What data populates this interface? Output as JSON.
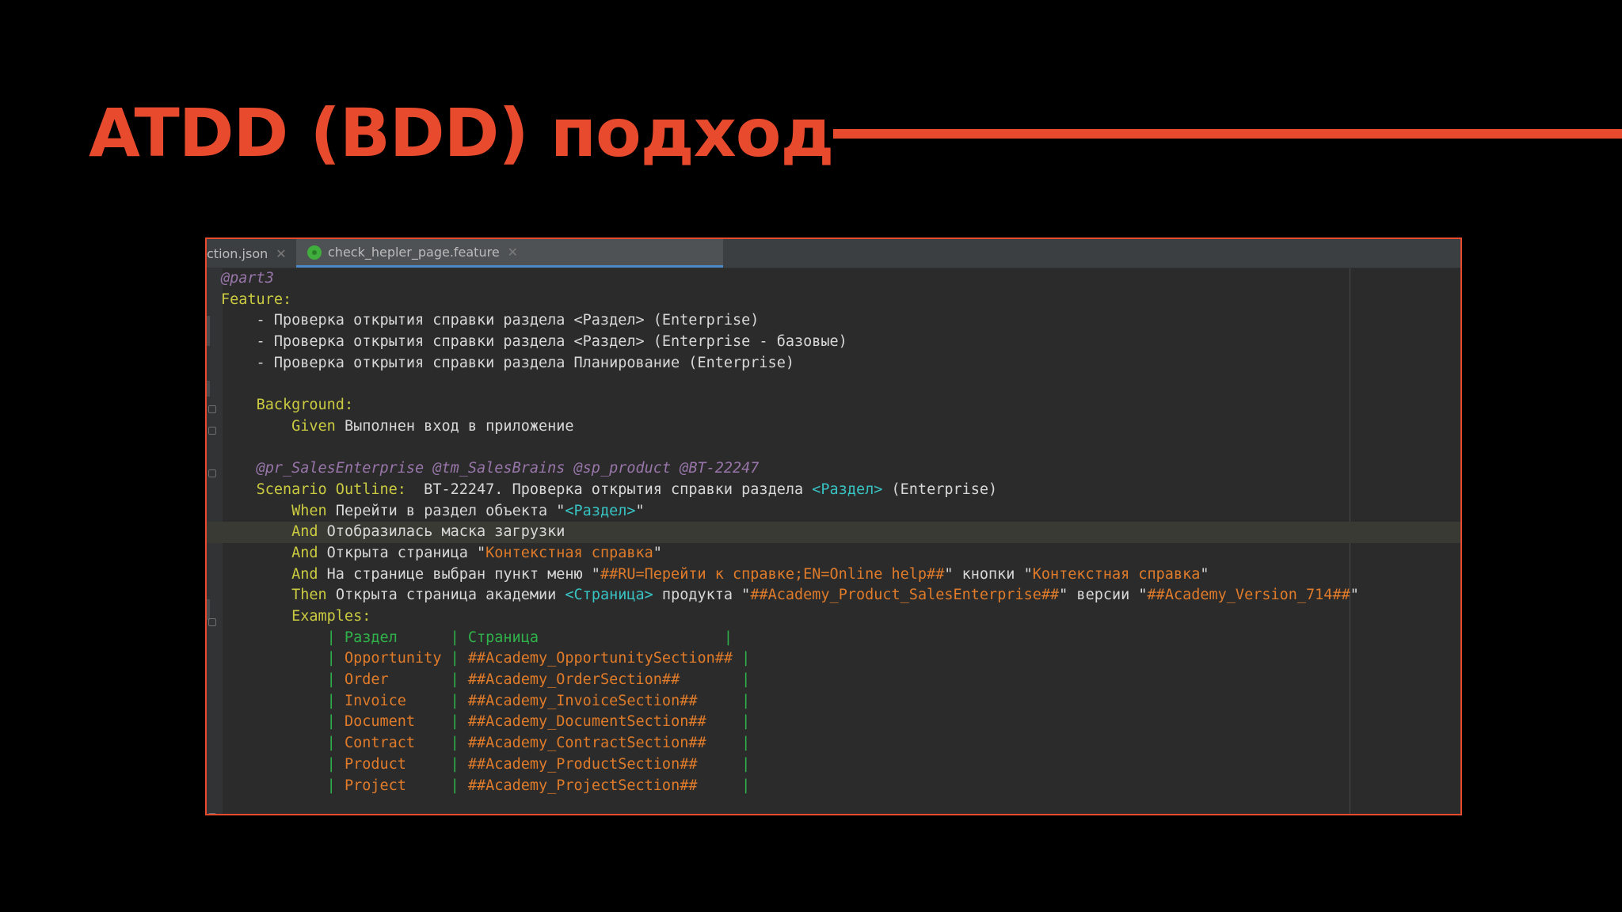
{
  "slide": {
    "title": "ATDD (BDD) подход",
    "accent_color": "#e84a2e",
    "background_color": "#000000"
  },
  "editor": {
    "tabs": [
      {
        "label": "ction.json",
        "active": false,
        "close_icon": "close-icon"
      },
      {
        "label": "check_hepler_page.feature",
        "active": true,
        "icon": "feature-file-icon",
        "close_icon": "close-icon"
      }
    ],
    "colors": {
      "background": "#2b2b2b",
      "tag": "#9876aa",
      "keyword": "#cbcb41",
      "placeholder": "#38c4c4",
      "string": "#e07b2a",
      "table": "#2fb34a",
      "text": "#d8d8d8"
    },
    "lines": [
      [
        {
          "t": "tag",
          "v": "@part3"
        }
      ],
      [
        {
          "t": "kw",
          "v": "Feature:"
        }
      ],
      [
        {
          "t": "txt",
          "v": "    - Проверка открытия справки раздела <Раздел> (Enterprise)"
        }
      ],
      [
        {
          "t": "txt",
          "v": "    - Проверка открытия справки раздела <Раздел> (Enterprise - базовые)"
        }
      ],
      [
        {
          "t": "txt",
          "v": "    - Проверка открытия справки раздела Планирование (Enterprise)"
        }
      ],
      [
        {
          "t": "txt",
          "v": ""
        }
      ],
      [
        {
          "t": "txt",
          "v": "    "
        },
        {
          "t": "kw",
          "v": "Background:"
        }
      ],
      [
        {
          "t": "txt",
          "v": "        "
        },
        {
          "t": "kw",
          "v": "Given "
        },
        {
          "t": "txt",
          "v": "Выполнен вход в приложение"
        }
      ],
      [
        {
          "t": "txt",
          "v": ""
        }
      ],
      [
        {
          "t": "txt",
          "v": "    "
        },
        {
          "t": "tag",
          "v": "@pr_SalesEnterprise @tm_SalesBrains @sp_product @BT-22247"
        }
      ],
      [
        {
          "t": "txt",
          "v": "    "
        },
        {
          "t": "kw",
          "v": "Scenario Outline: "
        },
        {
          "t": "txt",
          "v": " BT-22247. Проверка открытия справки раздела "
        },
        {
          "t": "ph",
          "v": "<Раздел>"
        },
        {
          "t": "txt",
          "v": " (Enterprise)"
        }
      ],
      [
        {
          "t": "txt",
          "v": "        "
        },
        {
          "t": "kw",
          "v": "When "
        },
        {
          "t": "txt",
          "v": "Перейти в раздел объекта \""
        },
        {
          "t": "ph",
          "v": "<Раздел>"
        },
        {
          "t": "txt",
          "v": "\""
        }
      ],
      [
        {
          "t": "txt",
          "v": "        "
        },
        {
          "t": "kw",
          "v": "And "
        },
        {
          "t": "txt",
          "v": "Отобразилась маска загрузки"
        }
      ],
      [
        {
          "t": "txt",
          "v": "        "
        },
        {
          "t": "kw",
          "v": "And "
        },
        {
          "t": "txt",
          "v": "Открыта страница \""
        },
        {
          "t": "str",
          "v": "Контекстная справка"
        },
        {
          "t": "txt",
          "v": "\""
        }
      ],
      [
        {
          "t": "txt",
          "v": "        "
        },
        {
          "t": "kw",
          "v": "And "
        },
        {
          "t": "txt",
          "v": "На странице выбран пункт меню \""
        },
        {
          "t": "str",
          "v": "##RU=Перейти к справке;EN=Online help##"
        },
        {
          "t": "txt",
          "v": "\" кнопки \""
        },
        {
          "t": "str",
          "v": "Контекстная справка"
        },
        {
          "t": "txt",
          "v": "\""
        }
      ],
      [
        {
          "t": "txt",
          "v": "        "
        },
        {
          "t": "kw",
          "v": "Then "
        },
        {
          "t": "txt",
          "v": "Открыта страница академии "
        },
        {
          "t": "ph",
          "v": "<Страница>"
        },
        {
          "t": "txt",
          "v": " продукта \""
        },
        {
          "t": "str",
          "v": "##Academy_Product_SalesEnterprise##"
        },
        {
          "t": "txt",
          "v": "\" версии \""
        },
        {
          "t": "str",
          "v": "##Academy_Version_714##"
        },
        {
          "t": "txt",
          "v": "\""
        }
      ],
      [
        {
          "t": "txt",
          "v": "        "
        },
        {
          "t": "kw",
          "v": "Examples:"
        }
      ],
      [
        {
          "t": "txt",
          "v": "            "
        },
        {
          "t": "tbl",
          "v": "| Раздел      | Страница                     |"
        }
      ],
      [
        {
          "t": "txt",
          "v": "            "
        },
        {
          "t": "tbl",
          "v": "| "
        },
        {
          "t": "str",
          "v": "Opportunity"
        },
        {
          "t": "tbl",
          "v": " | "
        },
        {
          "t": "str",
          "v": "##Academy_OpportunitySection##"
        },
        {
          "t": "tbl",
          "v": " |"
        }
      ],
      [
        {
          "t": "txt",
          "v": "            "
        },
        {
          "t": "tbl",
          "v": "| "
        },
        {
          "t": "str",
          "v": "Order      "
        },
        {
          "t": "tbl",
          "v": " | "
        },
        {
          "t": "str",
          "v": "##Academy_OrderSection##      "
        },
        {
          "t": "tbl",
          "v": " |"
        }
      ],
      [
        {
          "t": "txt",
          "v": "            "
        },
        {
          "t": "tbl",
          "v": "| "
        },
        {
          "t": "str",
          "v": "Invoice    "
        },
        {
          "t": "tbl",
          "v": " | "
        },
        {
          "t": "str",
          "v": "##Academy_InvoiceSection##    "
        },
        {
          "t": "tbl",
          "v": " |"
        }
      ],
      [
        {
          "t": "txt",
          "v": "            "
        },
        {
          "t": "tbl",
          "v": "| "
        },
        {
          "t": "str",
          "v": "Document   "
        },
        {
          "t": "tbl",
          "v": " | "
        },
        {
          "t": "str",
          "v": "##Academy_DocumentSection##   "
        },
        {
          "t": "tbl",
          "v": " |"
        }
      ],
      [
        {
          "t": "txt",
          "v": "            "
        },
        {
          "t": "tbl",
          "v": "| "
        },
        {
          "t": "str",
          "v": "Contract   "
        },
        {
          "t": "tbl",
          "v": " | "
        },
        {
          "t": "str",
          "v": "##Academy_ContractSection##   "
        },
        {
          "t": "tbl",
          "v": " |"
        }
      ],
      [
        {
          "t": "txt",
          "v": "            "
        },
        {
          "t": "tbl",
          "v": "| "
        },
        {
          "t": "str",
          "v": "Product    "
        },
        {
          "t": "tbl",
          "v": " | "
        },
        {
          "t": "str",
          "v": "##Academy_ProductSection##    "
        },
        {
          "t": "tbl",
          "v": " |"
        }
      ],
      [
        {
          "t": "txt",
          "v": "            "
        },
        {
          "t": "tbl",
          "v": "| "
        },
        {
          "t": "str",
          "v": "Project    "
        },
        {
          "t": "tbl",
          "v": " | "
        },
        {
          "t": "str",
          "v": "##Academy_ProjectSection##    "
        },
        {
          "t": "tbl",
          "v": " |"
        }
      ]
    ],
    "current_line": 13
  }
}
